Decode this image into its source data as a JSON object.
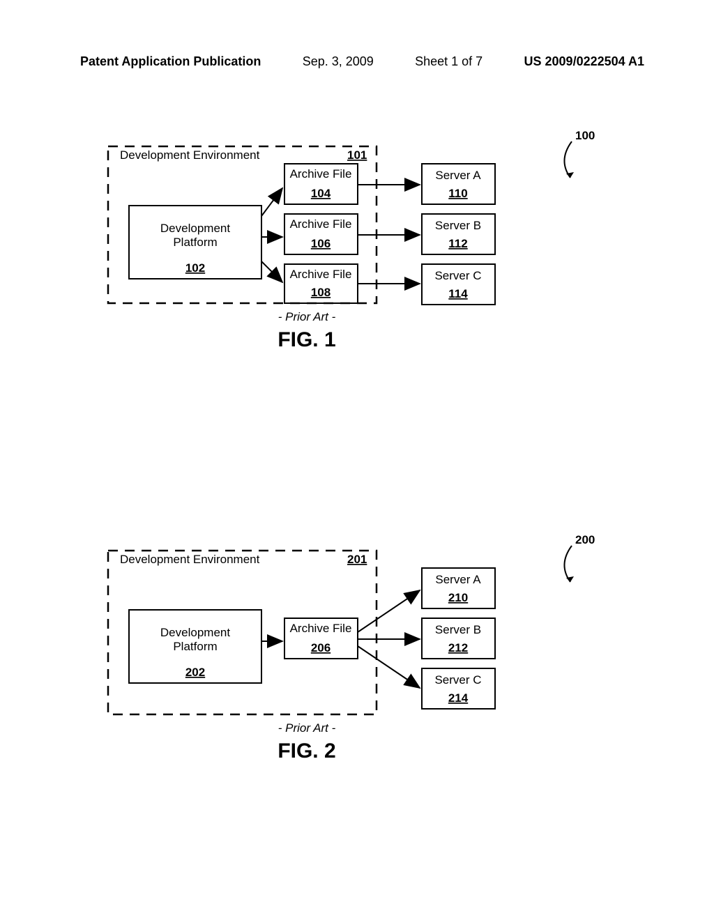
{
  "header": {
    "publication": "Patent Application Publication",
    "date": "Sep. 3, 2009",
    "sheet": "Sheet 1 of 7",
    "docnum": "US 2009/0222504 A1"
  },
  "fig1": {
    "caption": "FIG. 1",
    "prior_art": "- Prior Art -",
    "system_ref": "100",
    "env_label": "Development Environment",
    "env_num": "101",
    "platform_label1": "Development",
    "platform_label2": "Platform",
    "platform_num": "102",
    "archive_label": "Archive File",
    "archive_104": "104",
    "archive_106": "106",
    "archive_108": "108",
    "server_a_label": "Server A",
    "server_a_num": "110",
    "server_b_label": "Server B",
    "server_b_num": "112",
    "server_c_label": "Server C",
    "server_c_num": "114"
  },
  "fig2": {
    "caption": "FIG. 2",
    "prior_art": "- Prior Art -",
    "system_ref": "200",
    "env_label": "Development Environment",
    "env_num": "201",
    "platform_label1": "Development",
    "platform_label2": "Platform",
    "platform_num": "202",
    "archive_label": "Archive File",
    "archive_num": "206",
    "server_a_label": "Server A",
    "server_a_num": "210",
    "server_b_label": "Server B",
    "server_b_num": "212",
    "server_c_label": "Server C",
    "server_c_num": "214"
  }
}
